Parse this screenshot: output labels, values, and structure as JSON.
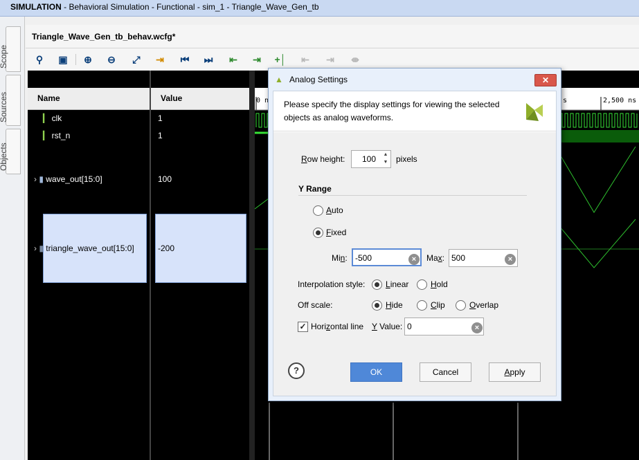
{
  "window": {
    "app": "SIMULATION",
    "title_rest": " - Behavioral Simulation - Functional - sim_1 - Triangle_Wave_Gen_tb"
  },
  "side_tabs": [
    "Scope",
    "Sources",
    "Objects"
  ],
  "editor": {
    "tab_title": "Triangle_Wave_Gen_tb_behav.wcfg*"
  },
  "toolbar": {
    "icons": [
      "search-icon",
      "save-icon",
      "zoom-in-icon",
      "zoom-out-icon",
      "zoom-fit-icon",
      "go-to-cursor-icon",
      "go-to-time-0-icon",
      "go-to-last-time-icon",
      "previous-transition-icon",
      "next-transition-icon",
      "add-marker-icon",
      "previous-marker-icon",
      "next-marker-icon",
      "swap-cursors-icon"
    ]
  },
  "columns": {
    "name": "Name",
    "value": "Value"
  },
  "signals": [
    {
      "name": "clk",
      "value": "1",
      "icon": "bit-signal-icon"
    },
    {
      "name": "rst_n",
      "value": "1",
      "icon": "bit-signal-icon"
    },
    {
      "name": "wave_out[15:0]",
      "value": "100",
      "icon": "bus-signal-icon"
    },
    {
      "name": "triangle_wave_out[15:0]",
      "value": "-200",
      "icon": "analog-bus-signal-icon"
    }
  ],
  "timeline": {
    "left_label": "0 ns",
    "right_label": "2,500 ns",
    "mid_label": "s"
  },
  "dialog": {
    "title": "Analog Settings",
    "description": "Please specify the display settings for viewing the selected objects as analog waveforms.",
    "row_height": {
      "label": "Row height:",
      "value": "100",
      "unit": "pixels"
    },
    "y_range": {
      "heading": "Y Range",
      "auto_label": "Auto",
      "fixed_label": "Fixed",
      "selected": "Fixed",
      "min_label": "Min:",
      "min_value": "-500",
      "max_label": "Max:",
      "max_value": "500"
    },
    "interpolation": {
      "label": "Interpolation style:",
      "options": [
        "Linear",
        "Hold"
      ],
      "selected": "Linear"
    },
    "off_scale": {
      "label": "Off scale:",
      "options": [
        "Hide",
        "Clip",
        "Overlap"
      ],
      "selected": "Hide"
    },
    "horizontal_line": {
      "label": "Horizontal line",
      "checked": true,
      "y_label": "Y Value:",
      "y_value": "0"
    },
    "buttons": {
      "ok": "OK",
      "cancel": "Cancel",
      "apply": "Apply",
      "help": "?"
    },
    "close_glyph": "✕"
  }
}
